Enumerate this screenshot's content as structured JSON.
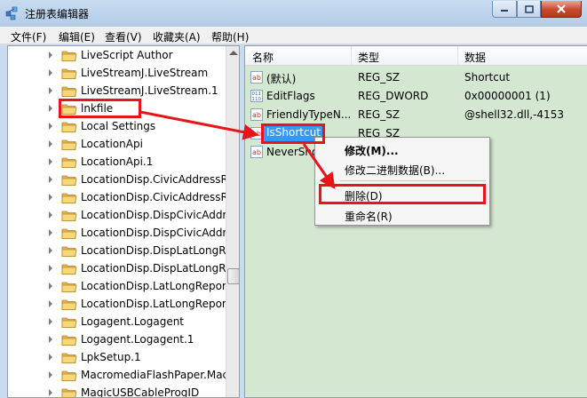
{
  "window": {
    "title": "注册表编辑器",
    "controls": {
      "minimize": "minimize-icon",
      "maximize": "maximize-icon",
      "close": "close-icon"
    }
  },
  "menubar": [
    {
      "label": "文件(F)"
    },
    {
      "label": "编辑(E)"
    },
    {
      "label": "查看(V)"
    },
    {
      "label": "收藏夹(A)"
    },
    {
      "label": "帮助(H)"
    }
  ],
  "tree": {
    "items": [
      {
        "label": "LiveScript Author"
      },
      {
        "label": "LiveStreamJ.LiveStream"
      },
      {
        "label": "LiveStreamJ.LiveStream.1"
      },
      {
        "label": "lnkfile"
      },
      {
        "label": "Local Settings"
      },
      {
        "label": "LocationApi"
      },
      {
        "label": "LocationApi.1"
      },
      {
        "label": "LocationDisp.CivicAddressRe"
      },
      {
        "label": "LocationDisp.CivicAddressRe"
      },
      {
        "label": "LocationDisp.DispCivicAddre"
      },
      {
        "label": "LocationDisp.DispCivicAddre"
      },
      {
        "label": "LocationDisp.DispLatLongRe"
      },
      {
        "label": "LocationDisp.DispLatLongRe"
      },
      {
        "label": "LocationDisp.LatLongReport"
      },
      {
        "label": "LocationDisp.LatLongReport"
      },
      {
        "label": "Logagent.Logagent"
      },
      {
        "label": "Logagent.Logagent.1"
      },
      {
        "label": "LpkSetup.1"
      },
      {
        "label": "MacromediaFlashPaper.Mac"
      },
      {
        "label": "MagicUSBCableProgID"
      }
    ]
  },
  "list": {
    "columns": {
      "name": "名称",
      "type": "类型",
      "data": "数据"
    },
    "rows": [
      {
        "name": "(默认)",
        "type": "REG_SZ",
        "data": "Shortcut",
        "icon": "string-value-icon"
      },
      {
        "name": "EditFlags",
        "type": "REG_DWORD",
        "data": "0x00000001 (1)",
        "icon": "binary-value-icon"
      },
      {
        "name": "FriendlyTypeN...",
        "type": "REG_SZ",
        "data": "@shell32.dll,-4153",
        "icon": "string-value-icon"
      },
      {
        "name": "IsShortcut",
        "type": "REG_SZ",
        "data": "",
        "icon": "string-value-icon"
      },
      {
        "name": "NeverSho",
        "type": "",
        "data": "",
        "icon": "string-value-icon"
      }
    ]
  },
  "context_menu": {
    "items": [
      {
        "label": "修改(M)..."
      },
      {
        "label": "修改二进制数据(B)..."
      },
      {
        "label": "删除(D)"
      },
      {
        "label": "重命名(R)"
      }
    ]
  },
  "colors": {
    "annotation": "#e8141a",
    "selection": "#3399ff",
    "list_background": "#d3e7d1"
  }
}
